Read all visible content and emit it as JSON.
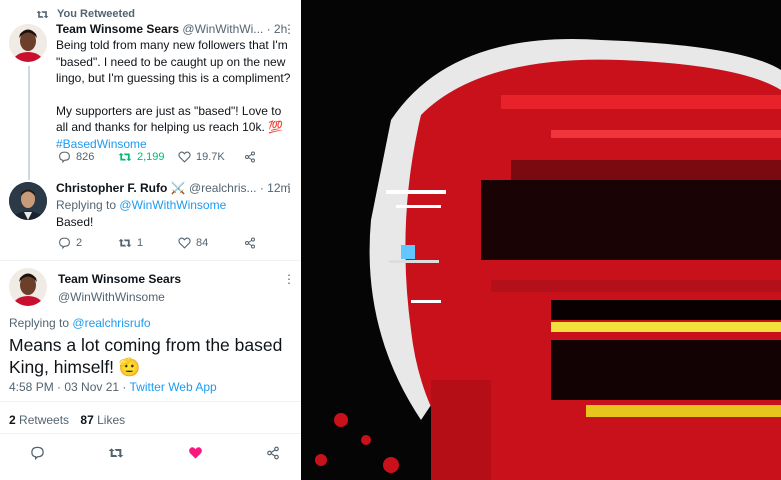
{
  "retweet_banner": {
    "label": "You Retweeted"
  },
  "tweet1": {
    "name": "Team Winsome Sears",
    "handle_time": "@WinWithWi... · 2h",
    "line1": "Being told from many new followers that I'm",
    "line2": "\"based\". I need to be caught up on the new",
    "line3": "lingo, but I'm guessing this is a compliment?",
    "line4": "My supporters are just as \"based\"! Love to",
    "line5": "all and thanks for helping us reach 10k. 💯",
    "hashtag": "#BasedWinsome",
    "replies": "826",
    "retweets": "2,199",
    "likes": "19.7K"
  },
  "tweet2": {
    "name": "Christopher F. Rufo ⚔️",
    "handle_time": "@realchris... · 12m",
    "replying_prefix": "Replying to",
    "replying_handle": "@WinWithWinsome",
    "text": "Based!",
    "replies": "2",
    "retweets": "1",
    "likes": "84"
  },
  "tweet3": {
    "name": "Team Winsome Sears",
    "handle": "@WinWithWinsome",
    "replying_prefix": "Replying to",
    "replying_handle": "@realchrisrufo",
    "text_line1": "Means a lot coming from the based",
    "text_line2": "King, himself! 🫡",
    "timestamp": "4:58 PM · 03 Nov 21 ·",
    "source": "Twitter Web App",
    "retweet_count": "2",
    "retweet_label": "Retweets",
    "like_count": "87",
    "like_label": "Likes"
  },
  "colors": {
    "accent": "#1d9bf0",
    "retweet_green": "#00ba7c",
    "like_pink": "#f91880",
    "meme_red": "#d5121b"
  },
  "icons": [
    "retweet-icon",
    "reply-icon",
    "like-icon",
    "share-icon",
    "more-icon"
  ]
}
